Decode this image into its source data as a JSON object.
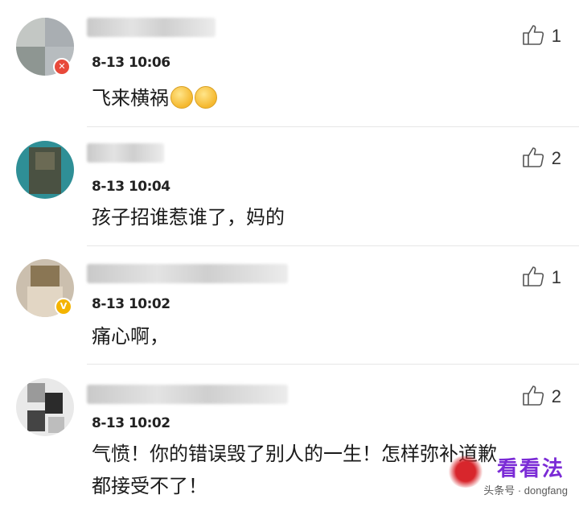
{
  "comments": [
    {
      "time": "8-13 10:06",
      "text": "飞来横祸",
      "emoji_count": 2,
      "likes": "1",
      "badge": "red"
    },
    {
      "time": "8-13 10:04",
      "text": "孩子招谁惹谁了，妈的",
      "emoji_count": 0,
      "likes": "2",
      "badge": ""
    },
    {
      "time": "8-13 10:02",
      "text": "痛心啊，",
      "emoji_count": 0,
      "likes": "1",
      "badge": "gold"
    },
    {
      "time": "8-13 10:02",
      "text_lines": [
        "气愤！你的错误毁了别人的一生！怎样弥补道歉",
        "都接受不了！"
      ],
      "emoji_count": 0,
      "likes": "2",
      "badge": ""
    }
  ],
  "watermark": {
    "brand": "看看法",
    "url": "头条号 · dongfang"
  },
  "icons": {
    "like": "thumbs-up-icon",
    "emoji": "sad-face-emoji-icon"
  }
}
